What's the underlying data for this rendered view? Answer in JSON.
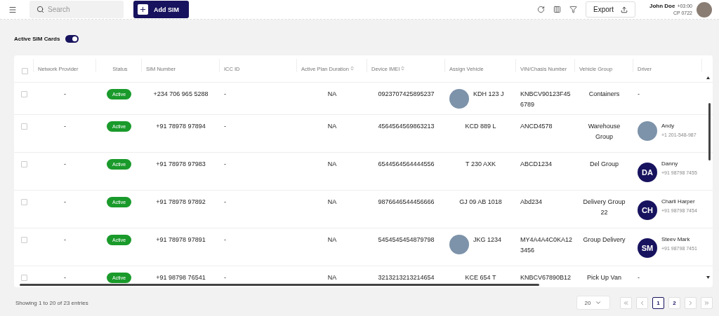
{
  "topbar": {
    "search": {
      "placeholder": "Search"
    },
    "add_button": "Add SIM",
    "export_button": "Export",
    "user": {
      "name": "John Doe",
      "timezone": "+03:00",
      "code": "CP 0722"
    }
  },
  "filter": {
    "label": "Active SIM Cards",
    "on": true
  },
  "table": {
    "header_checked": false,
    "columns": [
      {
        "label": "Network Provider",
        "sortable": false
      },
      {
        "label": "Status",
        "sortable": false
      },
      {
        "label": "SIM Number",
        "sortable": false
      },
      {
        "label": "ICC ID",
        "sortable": false
      },
      {
        "label": "Active Plan Duration",
        "sortable": true
      },
      {
        "label": "Device IMEI",
        "sortable": true
      },
      {
        "label": "Assign Vehicle",
        "sortable": false
      },
      {
        "label": "VIN/Chasis Number",
        "sortable": false
      },
      {
        "label": "Vehicle Group",
        "sortable": false
      },
      {
        "label": "Driver",
        "sortable": false
      }
    ],
    "rows": [
      {
        "checked": false,
        "network_provider": "-",
        "status": "Active",
        "sim_number": "+234 706 965 5288",
        "icc_id": "-",
        "plan_duration": "NA",
        "imei": "0923707425895237",
        "vehicle": {
          "plate": "KDH 123 J",
          "photo": true
        },
        "vin": "KNBCV90123F456789",
        "vehicle_group": "Containers",
        "driver": {
          "kind": "none",
          "text": "-"
        }
      },
      {
        "checked": false,
        "network_provider": "-",
        "status": "Active",
        "sim_number": "+91 78978 97894",
        "icc_id": "-",
        "plan_duration": "NA",
        "imei": "4564564569863213",
        "vehicle": {
          "plate": "KCD 889 L",
          "photo": false
        },
        "vin": "ANCD4578",
        "vehicle_group": "Warehouse Group",
        "driver": {
          "kind": "photo",
          "name": "Andy",
          "phone": "+1 201-548-987"
        }
      },
      {
        "checked": false,
        "network_provider": "-",
        "status": "Active",
        "sim_number": "+91 78978 97983",
        "icc_id": "-",
        "plan_duration": "NA",
        "imei": "6544564564444556",
        "vehicle": {
          "plate": "T 230 AXK",
          "photo": false
        },
        "vin": "ABCD1234",
        "vehicle_group": "Del Group",
        "driver": {
          "kind": "initials",
          "initials": "DA",
          "name": "Danny",
          "phone": "+91 98798 7455"
        }
      },
      {
        "checked": false,
        "network_provider": "-",
        "status": "Active",
        "sim_number": "+91 78978 97892",
        "icc_id": "-",
        "plan_duration": "NA",
        "imei": "9876646544456666",
        "vehicle": {
          "plate": "GJ 09 AB 1018",
          "photo": false
        },
        "vin": "Abd234",
        "vehicle_group": "Delivery Group 22",
        "driver": {
          "kind": "initials",
          "initials": "CH",
          "name": "Charli Harper",
          "phone": "+91 98798 7454"
        }
      },
      {
        "checked": false,
        "network_provider": "-",
        "status": "Active",
        "sim_number": "+91 78978 97891",
        "icc_id": "-",
        "plan_duration": "NA",
        "imei": "5454545454879798",
        "vehicle": {
          "plate": "JKG 1234",
          "photo": true
        },
        "vin": "MY4A4A4C0KA123456",
        "vehicle_group": "Group Delivery",
        "driver": {
          "kind": "initials",
          "initials": "SM",
          "name": "Steev Mark",
          "phone": "+91 98798 7451"
        }
      },
      {
        "checked": false,
        "network_provider": "-",
        "status": "Active",
        "sim_number": "+91 98798 76541",
        "icc_id": "-",
        "plan_duration": "NA",
        "imei": "3213213213214654",
        "vehicle": {
          "plate": "KCE 654 T",
          "photo": false
        },
        "vin": "KNBCV67890B12",
        "vehicle_group": "Pick Up Van",
        "driver": {
          "kind": "none",
          "text": "-"
        }
      }
    ]
  },
  "footer": {
    "summary": "Showing 1 to 20 of 23 entries",
    "page_size": "20",
    "pages": [
      {
        "label": "1",
        "selected": true
      },
      {
        "label": "2",
        "selected": false
      }
    ]
  }
}
